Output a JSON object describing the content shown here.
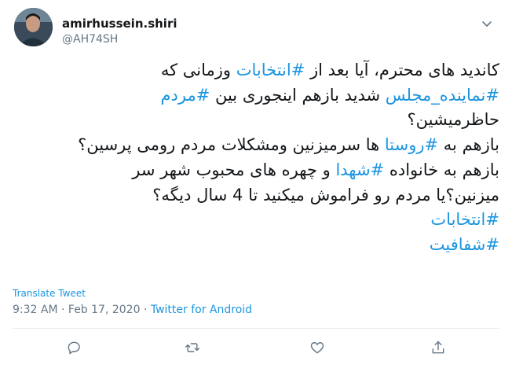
{
  "tweet": {
    "display_name": "amirhussein.shiri",
    "handle": "@AH74SH",
    "body_lines": [
      [
        {
          "t": "کاندید های محترم،  آیا بعد از "
        },
        {
          "t": "#انتخابات",
          "tag": true
        },
        {
          "t": " وزمانی که"
        }
      ],
      [
        {
          "t": "#نماینده_مجلس",
          "tag": true
        },
        {
          "t": " شدید بازهم اینجوری بین "
        },
        {
          "t": "#مردم",
          "tag": true
        }
      ],
      [
        {
          "t": "حاظرمیشین؟"
        }
      ],
      [
        {
          "t": "بازهم به "
        },
        {
          "t": "#روستا",
          "tag": true
        },
        {
          "t": " ها سرمیزنین ومشکلات مردم رومی پرسین؟"
        }
      ],
      [
        {
          "t": "بازهم به خانواده "
        },
        {
          "t": "#شهدا",
          "tag": true
        },
        {
          "t": " و چهره های محبوب شهر سر"
        }
      ],
      [
        {
          "t": "میزنین؟یا مردم رو فراموش میکنید تا 4 سال دیگه؟"
        }
      ],
      [
        {
          "t": "#انتخابات",
          "tag": true
        }
      ],
      [
        {
          "t": "#شفافیت",
          "tag": true
        }
      ]
    ],
    "translate_label": "Translate Tweet",
    "time": "9:32 AM",
    "date": "Feb 17, 2020",
    "source": "Twitter for Android",
    "separator": "·"
  },
  "icons": {
    "caret": "chevron-down-icon",
    "reply": "reply-icon",
    "retweet": "retweet-icon",
    "like": "heart-icon",
    "share": "share-icon"
  },
  "colors": {
    "hashtag": "#1b95e0",
    "secondary_text": "#657786",
    "icon": "#657786"
  }
}
